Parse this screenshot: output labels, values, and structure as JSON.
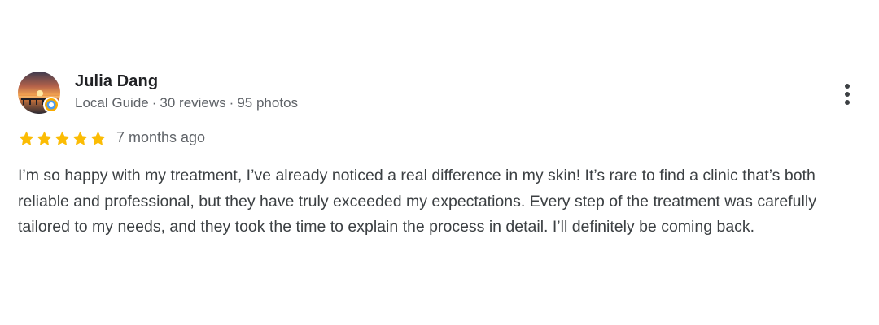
{
  "review": {
    "author": {
      "name": "Julia Dang",
      "badge": "Local Guide",
      "reviews": "30 reviews",
      "photos": "95 photos",
      "separator": "·",
      "avatar_icon": "sunset-avatar",
      "badge_icon": "local-guide-badge-icon"
    },
    "rating": {
      "stars": 5,
      "max": 5,
      "star_color": "#fbbc04"
    },
    "date": "7 months ago",
    "text": "I’m so happy with my treatment, I’ve already noticed a real difference in my skin! It’s rare to find a clinic that’s both reliable and professional, but they have truly exceeded my expectations. Every step of the treatment was carefully tailored to my needs, and they took the time to explain the process in detail. I’ll definitely be coming back.",
    "more_icon": "more-vert-icon"
  }
}
